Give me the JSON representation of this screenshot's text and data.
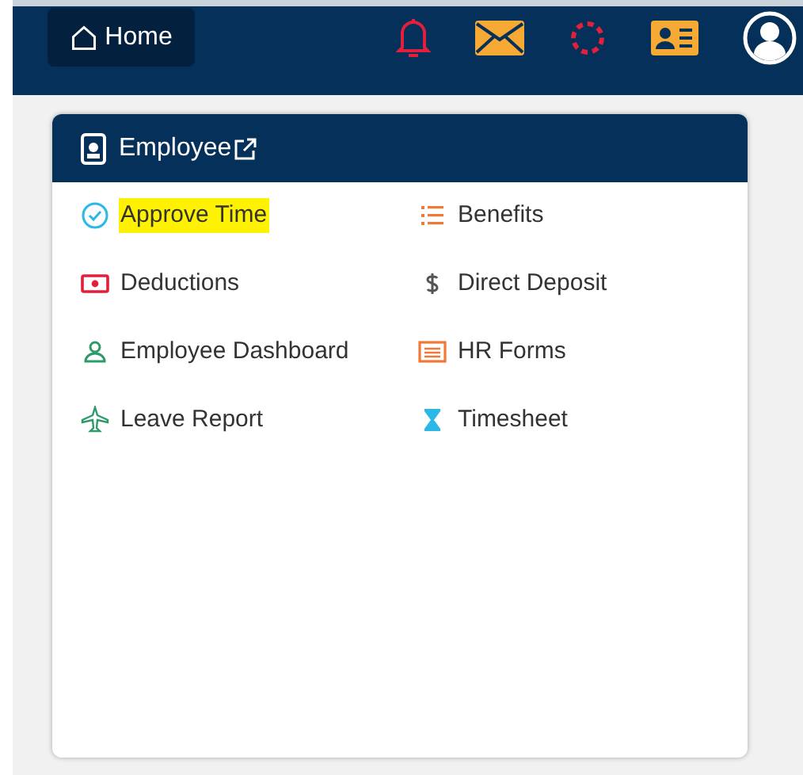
{
  "nav": {
    "home_button": "Home"
  },
  "card": {
    "title": "Employee",
    "items": [
      {
        "label": "Approve Time",
        "highlighted": true
      },
      {
        "label": "Benefits",
        "highlighted": false
      },
      {
        "label": "Deductions",
        "highlighted": false
      },
      {
        "label": "Direct Deposit",
        "highlighted": false
      },
      {
        "label": "Employee Dashboard",
        "highlighted": false
      },
      {
        "label": "HR Forms",
        "highlighted": false
      },
      {
        "label": "Leave Report",
        "highlighted": false
      },
      {
        "label": "Timesheet",
        "highlighted": false
      }
    ]
  }
}
